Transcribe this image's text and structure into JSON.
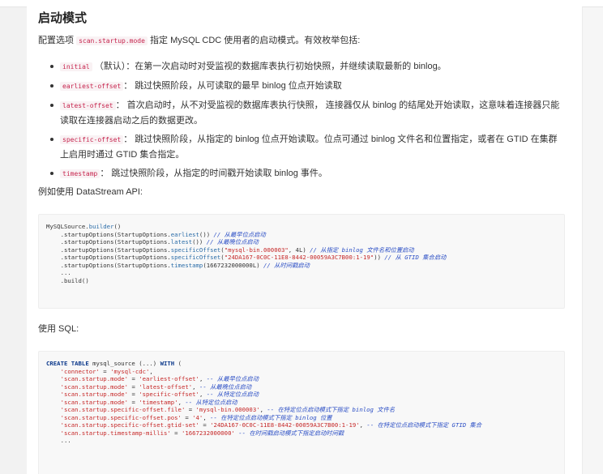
{
  "heading": "启动模式",
  "intro": {
    "before": "配置选项 ",
    "code": "scan.startup.mode",
    "after": " 指定 MySQL CDC 使用者的启动模式。有效枚举包括:"
  },
  "options": [
    {
      "code": "initial",
      "text": " （默认）：在第一次启动时对受监视的数据库表执行初始快照，并继续读取最新的 binlog。"
    },
    {
      "code": "earliest-offset",
      "text": "： 跳过快照阶段，从可读取的最早 binlog 位点开始读取"
    },
    {
      "code": "latest-offset",
      "text": "： 首次启动时，从不对受监视的数据库表执行快照， 连接器仅从 binlog 的结尾处开始读取，这意味着连接器只能读取在连接器启动之后的数据更改。"
    },
    {
      "code": "specific-offset",
      "text": "： 跳过快照阶段，从指定的 binlog 位点开始读取。位点可通过 binlog 文件名和位置指定，或者在 GTID 在集群上启用时通过 GTID 集合指定。"
    },
    {
      "code": "timestamp",
      "text": "： 跳过快照阶段，从指定的时间戳开始读取 binlog 事件。"
    }
  ],
  "datastream_label": "例如使用 DataStream API:",
  "java_lines": [
    [
      {
        "t": "",
        "v": "MySQLSource."
      },
      {
        "t": "fn",
        "v": "builder"
      },
      {
        "t": "",
        "v": "()"
      }
    ],
    [
      {
        "t": "",
        "v": "    .startupOptions(StartupOptions."
      },
      {
        "t": "fn",
        "v": "earliest"
      },
      {
        "t": "",
        "v": "()) "
      },
      {
        "t": "cm",
        "v": "// 从最早位点启动"
      }
    ],
    [
      {
        "t": "",
        "v": "    .startupOptions(StartupOptions."
      },
      {
        "t": "fn",
        "v": "latest"
      },
      {
        "t": "",
        "v": "()) "
      },
      {
        "t": "cm",
        "v": "// 从最晚位点启动"
      }
    ],
    [
      {
        "t": "",
        "v": "    .startupOptions(StartupOptions."
      },
      {
        "t": "fn",
        "v": "specificOffset"
      },
      {
        "t": "",
        "v": "("
      },
      {
        "t": "str",
        "v": "\"mysql-bin.000003\""
      },
      {
        "t": "",
        "v": ", 4L) "
      },
      {
        "t": "cm",
        "v": "// 从指定 binlog 文件名和位置启动"
      }
    ],
    [
      {
        "t": "",
        "v": "    .startupOptions(StartupOptions."
      },
      {
        "t": "fn",
        "v": "specificOffset"
      },
      {
        "t": "",
        "v": "("
      },
      {
        "t": "str",
        "v": "\"24DA167-0C0C-11E8-8442-00059A3C7B00:1-19\""
      },
      {
        "t": "",
        "v": ")) "
      },
      {
        "t": "cm",
        "v": "// 从 GTID 集合启动"
      }
    ],
    [
      {
        "t": "",
        "v": "    .startupOptions(StartupOptions."
      },
      {
        "t": "fn",
        "v": "timestamp"
      },
      {
        "t": "",
        "v": "(1667232000000L) "
      },
      {
        "t": "cm",
        "v": "// 从时间戳启动"
      }
    ],
    [
      {
        "t": "",
        "v": "    ..."
      }
    ],
    [
      {
        "t": "",
        "v": "    .build()"
      }
    ]
  ],
  "sql_label": "使用 SQL:",
  "sql_lines": [
    [
      {
        "t": "kw",
        "v": "CREATE TABLE"
      },
      {
        "t": "",
        "v": " mysql_source (...) "
      },
      {
        "t": "kw",
        "v": "WITH"
      },
      {
        "t": "",
        "v": " ("
      }
    ],
    [
      {
        "t": "",
        "v": "    "
      },
      {
        "t": "str",
        "v": "'connector'"
      },
      {
        "t": "",
        "v": " = "
      },
      {
        "t": "str",
        "v": "'mysql-cdc'"
      },
      {
        "t": "",
        "v": ","
      }
    ],
    [
      {
        "t": "",
        "v": "    "
      },
      {
        "t": "str",
        "v": "'scan.startup.mode'"
      },
      {
        "t": "",
        "v": " = "
      },
      {
        "t": "str",
        "v": "'earliest-offset'"
      },
      {
        "t": "",
        "v": ", "
      },
      {
        "t": "cm",
        "v": "-- 从最早位点启动"
      }
    ],
    [
      {
        "t": "",
        "v": "    "
      },
      {
        "t": "str",
        "v": "'scan.startup.mode'"
      },
      {
        "t": "",
        "v": " = "
      },
      {
        "t": "str",
        "v": "'latest-offset'"
      },
      {
        "t": "",
        "v": ", "
      },
      {
        "t": "cm",
        "v": "-- 从最晚位点启动"
      }
    ],
    [
      {
        "t": "",
        "v": "    "
      },
      {
        "t": "str",
        "v": "'scan.startup.mode'"
      },
      {
        "t": "",
        "v": " = "
      },
      {
        "t": "str",
        "v": "'specific-offset'"
      },
      {
        "t": "",
        "v": ", "
      },
      {
        "t": "cm",
        "v": "-- 从特定位点启动"
      }
    ],
    [
      {
        "t": "",
        "v": "    "
      },
      {
        "t": "str",
        "v": "'scan.startup.mode'"
      },
      {
        "t": "",
        "v": " = "
      },
      {
        "t": "str",
        "v": "'timestamp'"
      },
      {
        "t": "",
        "v": ", "
      },
      {
        "t": "cm",
        "v": "-- 从特定位点启动"
      }
    ],
    [
      {
        "t": "",
        "v": "    "
      },
      {
        "t": "str",
        "v": "'scan.startup.specific-offset.file'"
      },
      {
        "t": "",
        "v": " = "
      },
      {
        "t": "str",
        "v": "'mysql-bin.000003'"
      },
      {
        "t": "",
        "v": ", "
      },
      {
        "t": "cm",
        "v": "-- 在特定位点启动模式下指定 binlog 文件名"
      }
    ],
    [
      {
        "t": "",
        "v": "    "
      },
      {
        "t": "str",
        "v": "'scan.startup.specific-offset.pos'"
      },
      {
        "t": "",
        "v": " = "
      },
      {
        "t": "str",
        "v": "'4'"
      },
      {
        "t": "",
        "v": ", "
      },
      {
        "t": "cm",
        "v": "-- 在特定位点启动模式下指定 binlog 位置"
      }
    ],
    [
      {
        "t": "",
        "v": "    "
      },
      {
        "t": "str",
        "v": "'scan.startup.specific-offset.gtid-set'"
      },
      {
        "t": "",
        "v": " = "
      },
      {
        "t": "str",
        "v": "'24DA167-0C0C-11E8-8442-00059A3C7B00:1-19'"
      },
      {
        "t": "",
        "v": ", "
      },
      {
        "t": "cm",
        "v": "-- 在特定位点启动模式下指定 GTID 集合"
      }
    ],
    [
      {
        "t": "",
        "v": "    "
      },
      {
        "t": "str",
        "v": "'scan.startup.timestamp-millis'"
      },
      {
        "t": "",
        "v": " = "
      },
      {
        "t": "str",
        "v": "'1667232000000'"
      },
      {
        "t": "",
        "v": " "
      },
      {
        "t": "cm",
        "v": "-- 在时间戳启动模式下指定启动时间戳"
      }
    ],
    [
      {
        "t": "",
        "v": "    ..."
      }
    ]
  ]
}
